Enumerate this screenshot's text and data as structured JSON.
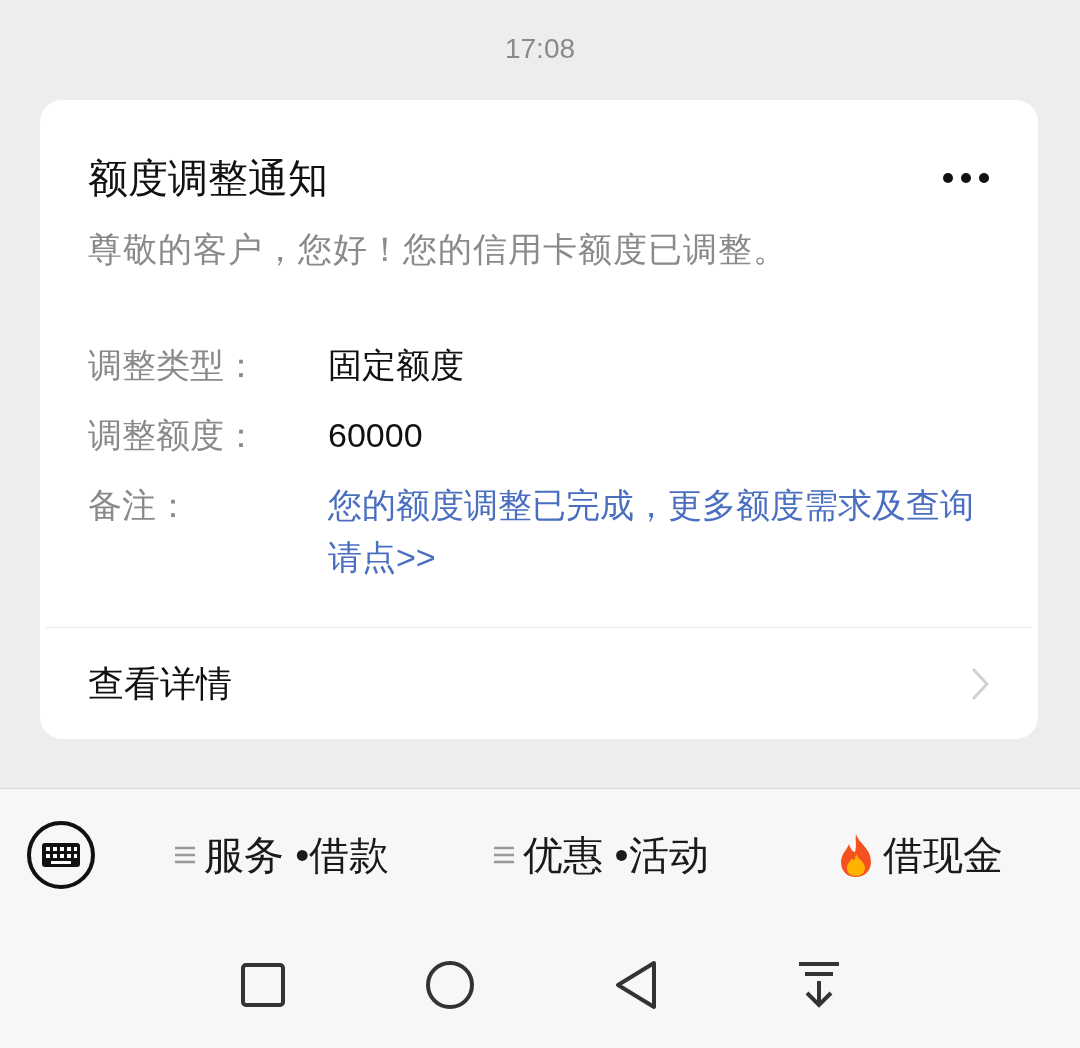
{
  "status_time": "17:08",
  "card": {
    "title": "额度调整通知",
    "subtitle": "尊敬的客户，您好！您的信用卡额度已调整。",
    "fields": [
      {
        "label": "调整类型：",
        "value": "固定额度",
        "kind": "text"
      },
      {
        "label": "调整额度：",
        "value": "60000",
        "kind": "text"
      },
      {
        "label": "备注：",
        "value": "您的额度调整已完成，更多额度需求及查询请点>>",
        "kind": "link"
      }
    ],
    "footer_link": "查看详情"
  },
  "menu_bar": {
    "items": [
      {
        "label": "服务 •借款",
        "kind": "menu"
      },
      {
        "label": "优惠 •活动",
        "kind": "menu"
      },
      {
        "label": "借现金",
        "kind": "hot"
      }
    ]
  }
}
